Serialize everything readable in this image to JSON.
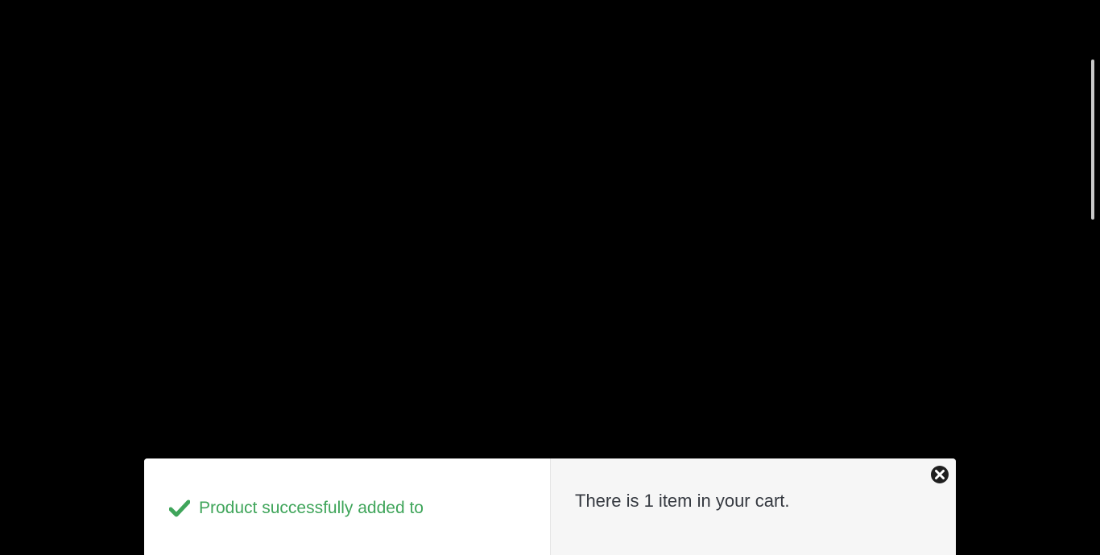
{
  "modal": {
    "success_message": "Product successfully added to",
    "cart_summary": "There is 1 item in your cart.",
    "close_icon": "close-circle-icon",
    "check_icon": "check-icon",
    "success_color": "#3fa55a"
  }
}
